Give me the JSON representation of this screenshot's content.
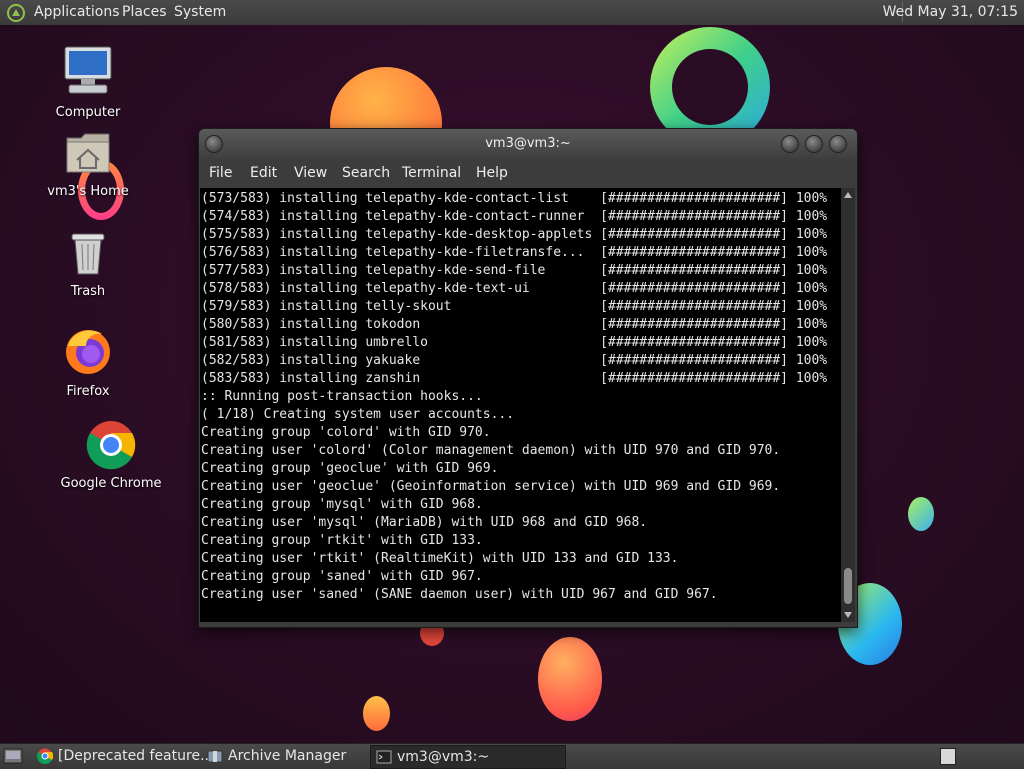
{
  "top_panel": {
    "menus": [
      "Applications",
      "Places",
      "System"
    ],
    "clock": "Wed May 31, 07:15"
  },
  "desktop_icons": [
    {
      "label": "Computer",
      "icon": "computer-icon"
    },
    {
      "label": "vm3's Home",
      "icon": "home-folder-icon"
    },
    {
      "label": "Trash",
      "icon": "trash-icon"
    },
    {
      "label": "Firefox",
      "icon": "firefox-icon"
    },
    {
      "label": "Google Chrome",
      "icon": "chrome-icon"
    }
  ],
  "terminal": {
    "title": "vm3@vm3:~",
    "menu": [
      "File",
      "Edit",
      "View",
      "Search",
      "Terminal",
      "Help"
    ],
    "lines": [
      "(573/583) installing telepathy-kde-contact-list    [######################] 100%",
      "(574/583) installing telepathy-kde-contact-runner  [######################] 100%",
      "(575/583) installing telepathy-kde-desktop-applets [######################] 100%",
      "(576/583) installing telepathy-kde-filetransfe...  [######################] 100%",
      "(577/583) installing telepathy-kde-send-file       [######################] 100%",
      "(578/583) installing telepathy-kde-text-ui         [######################] 100%",
      "(579/583) installing telly-skout                   [######################] 100%",
      "(580/583) installing tokodon                       [######################] 100%",
      "(581/583) installing umbrello                      [######################] 100%",
      "(582/583) installing yakuake                       [######################] 100%",
      "(583/583) installing zanshin                       [######################] 100%",
      ":: Running post-transaction hooks...",
      "( 1/18) Creating system user accounts...",
      "Creating group 'colord' with GID 970.",
      "Creating user 'colord' (Color management daemon) with UID 970 and GID 970.",
      "Creating group 'geoclue' with GID 969.",
      "Creating user 'geoclue' (Geoinformation service) with UID 969 and GID 969.",
      "Creating group 'mysql' with GID 968.",
      "Creating user 'mysql' (MariaDB) with UID 968 and GID 968.",
      "Creating group 'rtkit' with GID 133.",
      "Creating user 'rtkit' (RealtimeKit) with UID 133 and GID 133.",
      "Creating group 'saned' with GID 967.",
      "Creating user 'saned' (SANE daemon user) with UID 967 and GID 967."
    ]
  },
  "taskbar": {
    "tasks": [
      {
        "label": "[Deprecated feature...",
        "icon": "chrome-icon",
        "active": false
      },
      {
        "label": "Archive Manager",
        "icon": "archive-manager-icon",
        "active": false
      },
      {
        "label": "vm3@vm3:~",
        "icon": "terminal-icon",
        "active": true
      }
    ]
  }
}
